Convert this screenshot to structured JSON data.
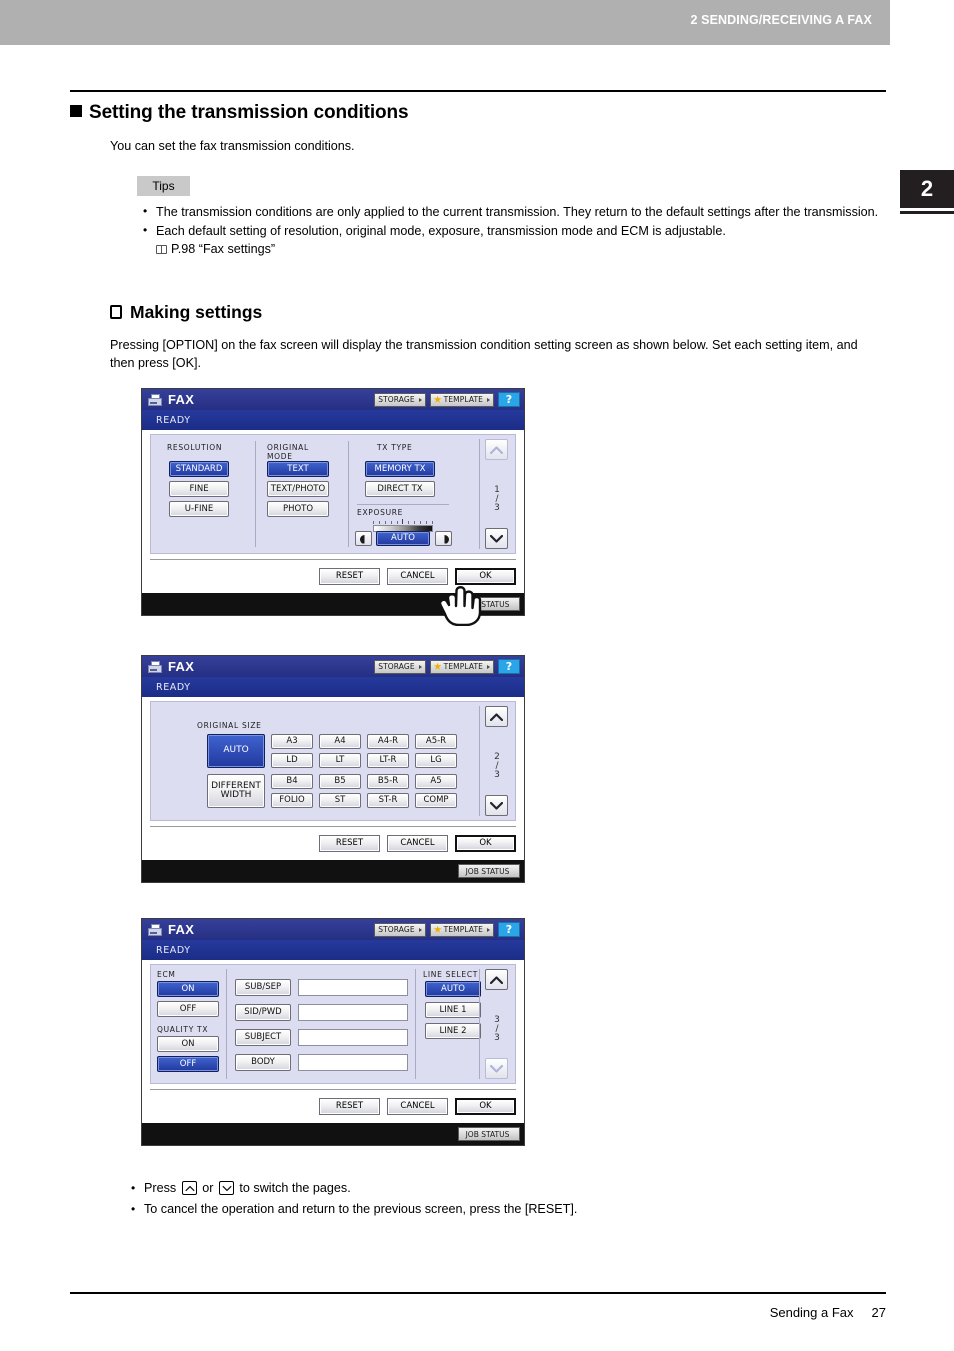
{
  "running_head": "2 SENDING/RECEIVING A FAX",
  "chapter_tab": "2",
  "headings": {
    "h1": "Setting the transmission conditions",
    "h2": "Making settings"
  },
  "intro": "You can set the fax transmission conditions.",
  "tips": {
    "badge": "Tips",
    "items": [
      "The transmission conditions are only applied to the current transmission. They return to the default settings after the transmission.",
      "Each default setting of resolution, original mode, exposure, transmission mode and ECM is adjustable."
    ],
    "reference": "P.98 “Fax settings”"
  },
  "para2": "Pressing [OPTION] on the fax screen will display the transmission condition setting screen as shown below. Set each setting item, and then press [OK].",
  "foot_notes": {
    "press_prefix": "Press",
    "press_or": "or",
    "press_suffix": "to switch the pages.",
    "cancel": "To cancel the operation and return to the previous screen, press the [RESET]."
  },
  "footer": {
    "title": "Sending a Fax",
    "page": "27"
  },
  "colors": {
    "titlebar": "#2d3a8c",
    "statusbar": "#1f3494",
    "selected_button": "#22399f",
    "panel": "#dcddf0",
    "help_button": "#2aa6e8",
    "runhead": "#b0b0b0",
    "chapter_tab": "#231f20"
  },
  "lcd_common": {
    "title": "FAX",
    "status": "READY",
    "storage": "STORAGE",
    "template": "TEMPLATE",
    "help": "?",
    "job_status": "JOB STATUS",
    "reset": "RESET",
    "cancel": "CANCEL",
    "ok": "OK"
  },
  "screens": [
    {
      "page_current": "1",
      "page_total": "3",
      "up_enabled": false,
      "down_enabled": true,
      "groups": [
        {
          "label": "RESOLUTION",
          "options": [
            "STANDARD",
            "FINE",
            "U-FINE"
          ],
          "selected": "STANDARD"
        },
        {
          "label": "ORIGINAL\nMODE",
          "options": [
            "TEXT",
            "TEXT/PHOTO",
            "PHOTO"
          ],
          "selected": "TEXT"
        },
        {
          "label": "TX  TYPE",
          "options": [
            "MEMORY TX",
            "DIRECT TX"
          ],
          "selected": "MEMORY TX"
        }
      ],
      "exposure": {
        "label": "EXPOSURE",
        "value": "AUTO",
        "selected": true,
        "lighter_icon": "half-circle-light-icon",
        "darker_icon": "half-circle-dark-icon"
      }
    },
    {
      "page_current": "2",
      "page_total": "3",
      "up_enabled": true,
      "down_enabled": true,
      "original_size": {
        "label": "ORIGINAL SIZE",
        "auto": "AUTO",
        "different_width": "DIFFERENT\nWIDTH",
        "selected": "AUTO",
        "grid": [
          [
            "A3",
            "A4",
            "A4-R",
            "A5-R"
          ],
          [
            "LD",
            "LT",
            "LT-R",
            "LG"
          ],
          [
            "B4",
            "B5",
            "B5-R",
            "A5"
          ],
          [
            "FOLIO",
            "ST",
            "ST-R",
            "COMP"
          ]
        ]
      }
    },
    {
      "page_current": "3",
      "page_total": "3",
      "up_enabled": true,
      "down_enabled": false,
      "ecm": {
        "label": "ECM",
        "options": [
          "ON",
          "OFF"
        ],
        "selected": "ON"
      },
      "quality_tx": {
        "label": "QUALITY TX",
        "options": [
          "ON",
          "OFF"
        ],
        "selected": "OFF"
      },
      "fields": [
        {
          "label": "SUB/SEP",
          "value": ""
        },
        {
          "label": "SID/PWD",
          "value": ""
        },
        {
          "label": "SUBJECT",
          "value": ""
        },
        {
          "label": "BODY",
          "value": ""
        }
      ],
      "line_select": {
        "label": "LINE  SELECT",
        "options": [
          "AUTO",
          "LINE 1",
          "LINE 2"
        ],
        "selected": "AUTO"
      }
    }
  ]
}
